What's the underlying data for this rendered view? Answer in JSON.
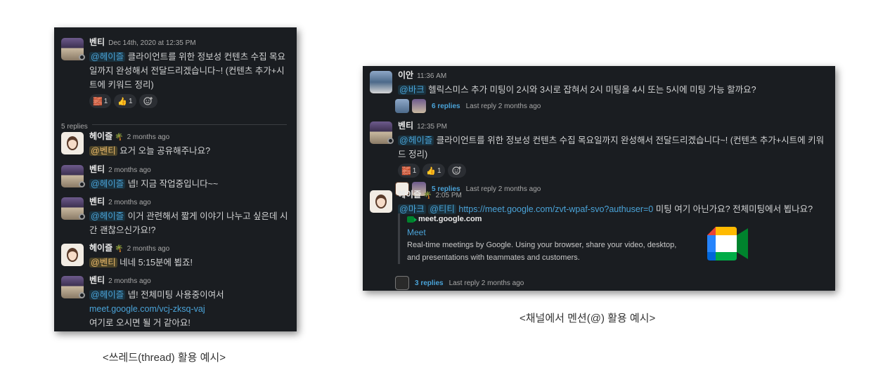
{
  "thread": {
    "root": {
      "name": "벤티",
      "time": "Dec 14th, 2020 at 12:35 PM",
      "mention": "@헤이즐",
      "text": "클라이언트를 위한 정보성 컨텐츠 수집 목요일까지 완성해서 전달드리겠습니다~! (컨텐츠 추가+시트에 키워드 정리)",
      "line1": " 클라이언트를 위한 정보성 컨텐츠 수집 목요",
      "line2": "일까지 완성해서 전달드리겠습니다~! (컨텐츠 추가+시",
      "line3": "트에 키워드 정리)",
      "reactions": [
        {
          "emoji": "🧱",
          "emoji_name": "custom-emoji",
          "count": "1"
        },
        {
          "emoji": "👍",
          "emoji_name": "thumbs-up",
          "count": "1"
        }
      ]
    },
    "replies_label": "5 replies",
    "replies": [
      {
        "name": "헤이즐",
        "time": "2 months ago",
        "mention": "@벤티",
        "text": " 요거 오늘 공유해주나요?"
      },
      {
        "name": "벤티",
        "time": "2 months ago",
        "mention": "@헤이즐",
        "text": " 넵! 지금 작업중입니다~~"
      },
      {
        "name": "벤티",
        "time": "2 months ago",
        "mention": "@헤이즐",
        "line1": " 이거 관련해서 짧게 이야기 나누고 싶은데 시",
        "line2": "간 괜찮으신가요!?"
      },
      {
        "name": "헤이즐",
        "time": "2 months ago",
        "mention": "@벤티",
        "text": " 네네 5:15분에 뵙죠!"
      },
      {
        "name": "벤티",
        "time": "2 months ago",
        "mention": "@헤이즐",
        "line1": " 넵! 전체미팅 사용중이여서",
        "link": "meet.google.com/vcj-zksq-vaj",
        "line3": "여기로 오시면 될 거 같아요!"
      }
    ]
  },
  "channel": {
    "messages": [
      {
        "name": "이안",
        "time": "11:36 AM",
        "mention": "@바크",
        "text": " 헬릭스미스 추가 미팅이 2시와 3시로 잡혀서 2시 미팅을 4시 또는 5시에 미팅 가능 할까요?",
        "reply_count": "6 replies",
        "last_reply": "Last reply 2 months ago"
      },
      {
        "name": "벤티",
        "time": "12:35 PM",
        "mention": "@헤이즐",
        "text": " 클라이언트를 위한 정보성 컨텐츠 수집 목요일까지 완성해서 전달드리겠습니다~! (컨텐츠 추가+시트에 키워드 정리)",
        "reactions": [
          {
            "emoji": "🧱",
            "emoji_name": "custom-emoji",
            "count": "1"
          },
          {
            "emoji": "👍",
            "emoji_name": "thumbs-up",
            "count": "1"
          }
        ],
        "reply_count": "5 replies",
        "last_reply": "Last reply 2 months ago"
      },
      {
        "name": "헤이즐",
        "time": "2:05 PM",
        "mention1": "@마크",
        "mention2": "@티티",
        "link": "https://meet.google.com/zvt-wpaf-svo?authuser=0",
        "text": " 미팅 여기 아닌가요? 전체미팅에서 뵙나요?",
        "unfurl": {
          "site": "meet.google.com",
          "title": "Meet",
          "description": "Real-time meetings by Google. Using your browser, share your video, desktop, and presentations with teammates and customers."
        },
        "reply_count": "3 replies",
        "last_reply": "Last reply 2 months ago"
      }
    ]
  },
  "captions": {
    "thread": "<쓰레드(thread) 활용 예시>",
    "channel": "<채널에서 멘션(@) 활용 예시>"
  },
  "colors": {
    "panel_bg": "#1a1d21",
    "link": "#4aa3d8",
    "mention_bg": "#1d9bd1",
    "mention_gold": "#f2c744"
  }
}
